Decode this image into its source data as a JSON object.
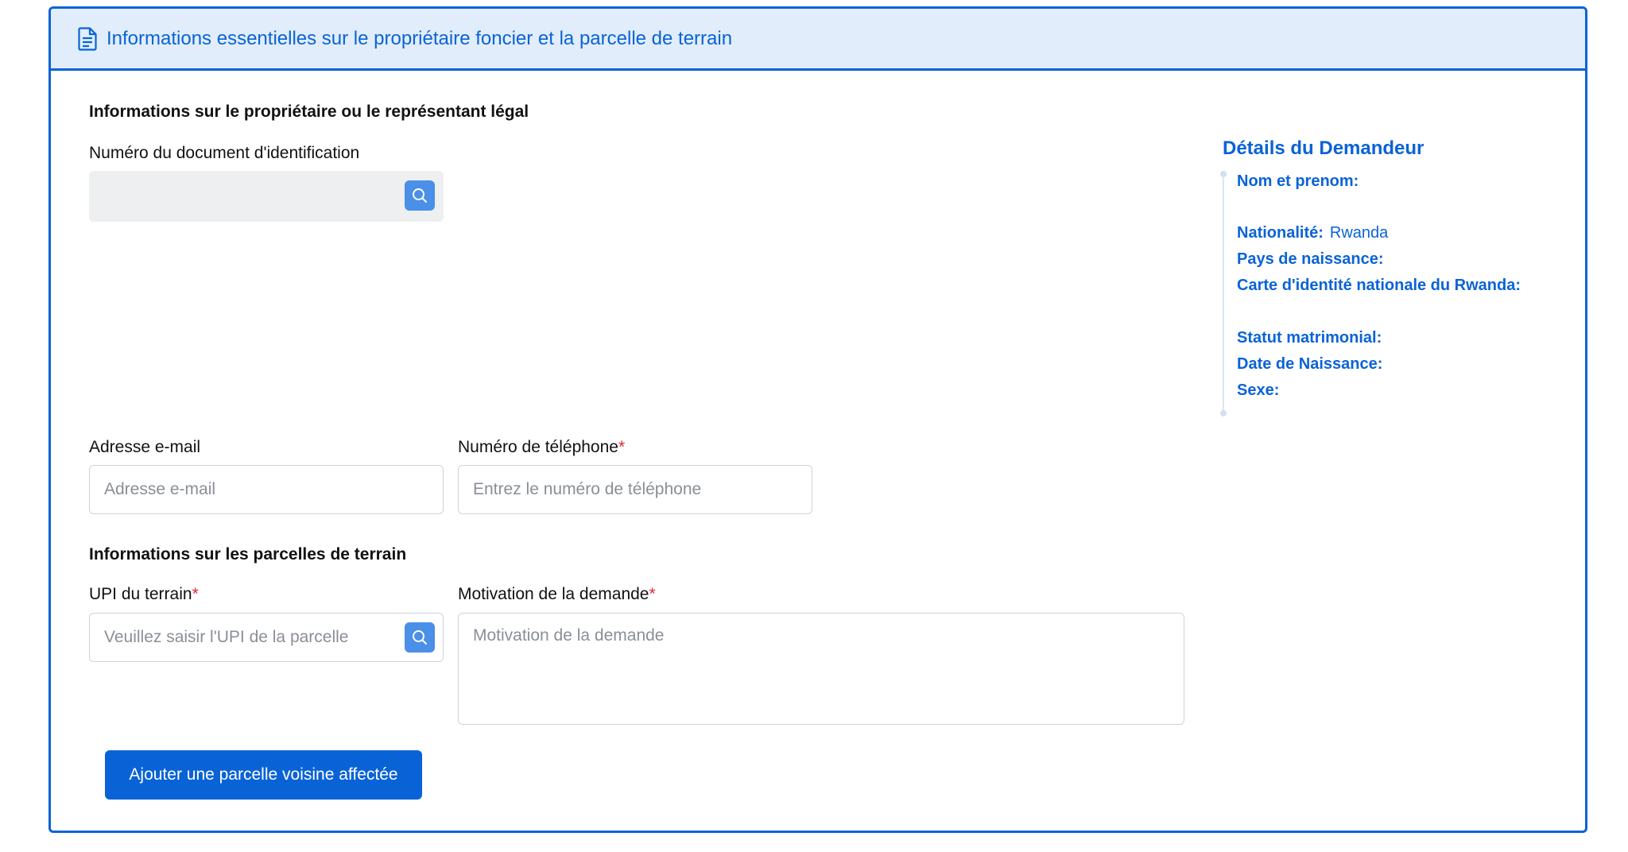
{
  "header": {
    "title": "Informations essentielles sur le propriétaire foncier et la parcelle de terrain",
    "icon": "document-icon"
  },
  "owner_section": {
    "title": "Informations sur le propriétaire ou le représentant légal",
    "id_label": "Numéro du document d'identification",
    "id_value": "",
    "email_label": "Adresse e-mail",
    "email_placeholder": "Adresse e-mail",
    "phone_label": "Numéro de téléphone",
    "phone_required": "*",
    "phone_placeholder": "Entrez le numéro de téléphone"
  },
  "parcel_section": {
    "title": "Informations sur les parcelles de terrain",
    "upi_label": "UPI du terrain",
    "upi_required": "*",
    "upi_placeholder": "Veuillez saisir l'UPI de la parcelle",
    "motivation_label": "Motivation de la demande",
    "motivation_required": "*",
    "motivation_placeholder": "Motivation de la demande"
  },
  "actions": {
    "add_parcel_label": "Ajouter une parcelle voisine affectée"
  },
  "applicant_details": {
    "title": "Détails du Demandeur",
    "rows": [
      {
        "key": "Nom et prenom:",
        "value": ""
      },
      {
        "key": "Nationalité:",
        "value": "Rwanda"
      },
      {
        "key": "Pays de naissance:",
        "value": ""
      },
      {
        "key": "Carte d'identité nationale du Rwanda:",
        "value": ""
      },
      {
        "key": "Statut matrimonial:",
        "value": ""
      },
      {
        "key": "Date de Naissance:",
        "value": ""
      },
      {
        "key": "Sexe:",
        "value": ""
      }
    ]
  },
  "colors": {
    "accent": "#0a63d6",
    "header_bg": "#e1edfb",
    "required": "#e0262e",
    "search_button": "#4a8fe8"
  }
}
